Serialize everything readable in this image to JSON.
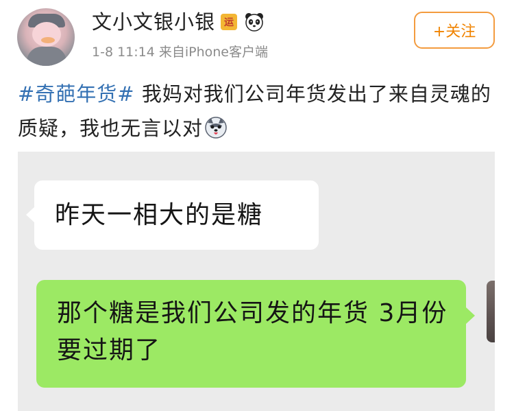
{
  "post": {
    "author": "文小文银小银",
    "badge_label": "运",
    "meta": "1-8 11:14  来自iPhone客户端",
    "follow_label": "+关注",
    "topic": "#奇葩年货#",
    "body": " 我妈对我们公司年货发出了来自灵魂的质疑，我也无言以对",
    "icons": {
      "avatar": "duck-avatar",
      "badge": "yun-badge",
      "panda": "panda-icon",
      "emoji": "husky-emoji"
    }
  },
  "chat": {
    "messages": [
      {
        "side": "left",
        "text": "昨天一相大的是糖"
      },
      {
        "side": "right",
        "text": "那个糖是我们公司发的年货 3月份要过期了"
      }
    ],
    "colors": {
      "background": "#ebebeb",
      "incoming": "#ffffff",
      "outgoing": "#9ce964"
    }
  },
  "colors": {
    "topic": "#3471b3",
    "follow": "#f08300",
    "meta": "#8b8b8b"
  }
}
